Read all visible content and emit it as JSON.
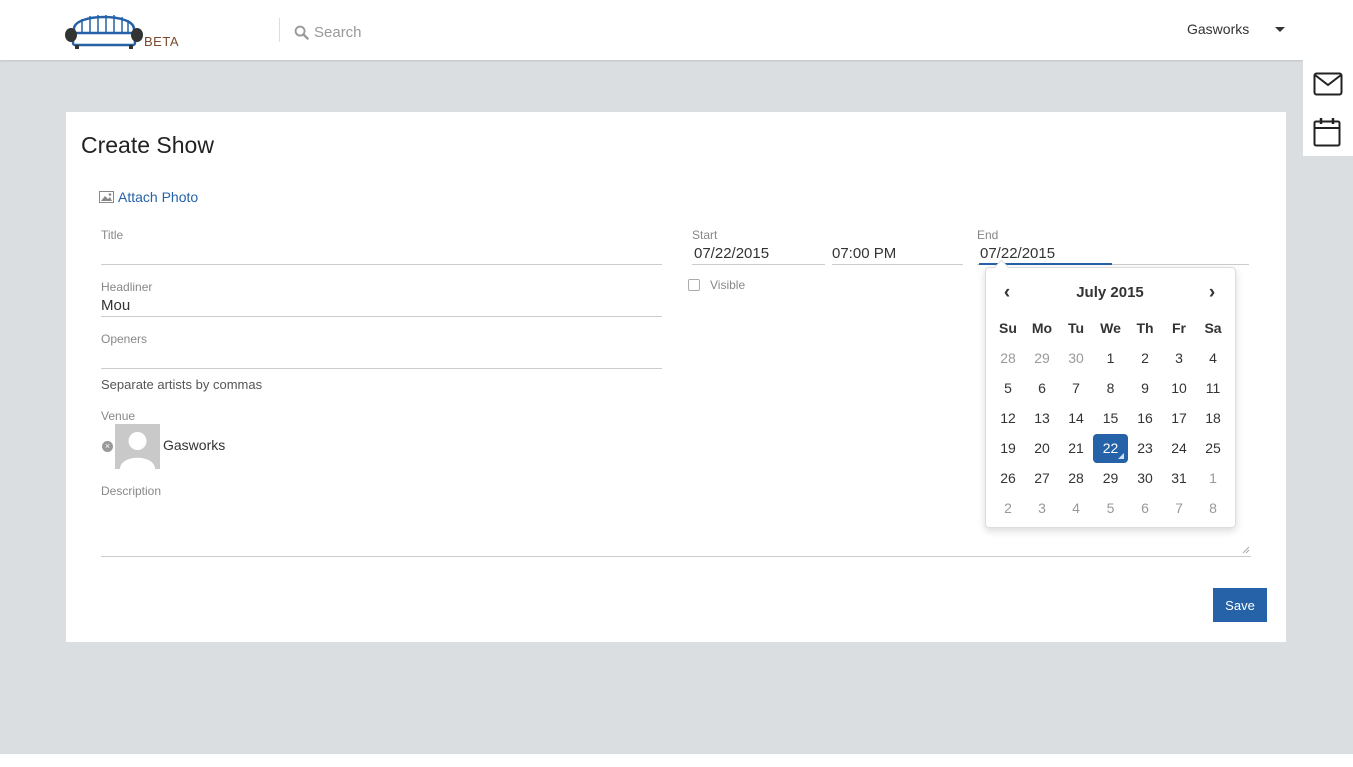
{
  "header": {
    "logo_label": "BETA",
    "search_placeholder": "Search",
    "user_menu_label": "Gasworks"
  },
  "dock": {
    "icons": [
      "envelope-icon",
      "calendar-icon"
    ]
  },
  "form": {
    "title": "Create Show",
    "attach_photo_label": "Attach Photo",
    "title_label": "Title",
    "title_value": "",
    "headliner_label": "Headliner",
    "headliner_value": "Mou",
    "openers_label": "Openers",
    "openers_value": "",
    "openers_hint": "Separate artists by commas",
    "venue_label": "Venue",
    "venue_name": "Gasworks",
    "description_label": "Description",
    "description_value": "",
    "start_label": "Start",
    "start_date": "07/22/2015",
    "start_time": "07:00 PM",
    "end_label": "End",
    "end_date": "07/22/2015",
    "visible_label": "Visible",
    "visible_checked": false,
    "save_label": "Save"
  },
  "datepicker": {
    "month_label": "July 2015",
    "prev_label": "‹",
    "next_label": "›",
    "weekdays": [
      "Su",
      "Mo",
      "Tu",
      "We",
      "Th",
      "Fr",
      "Sa"
    ],
    "weeks": [
      [
        {
          "d": "28",
          "m": "prev"
        },
        {
          "d": "29",
          "m": "prev"
        },
        {
          "d": "30",
          "m": "prev"
        },
        {
          "d": "1",
          "m": "cur"
        },
        {
          "d": "2",
          "m": "cur"
        },
        {
          "d": "3",
          "m": "cur"
        },
        {
          "d": "4",
          "m": "cur"
        }
      ],
      [
        {
          "d": "5",
          "m": "cur"
        },
        {
          "d": "6",
          "m": "cur"
        },
        {
          "d": "7",
          "m": "cur"
        },
        {
          "d": "8",
          "m": "cur"
        },
        {
          "d": "9",
          "m": "cur"
        },
        {
          "d": "10",
          "m": "cur"
        },
        {
          "d": "11",
          "m": "cur"
        }
      ],
      [
        {
          "d": "12",
          "m": "cur"
        },
        {
          "d": "13",
          "m": "cur"
        },
        {
          "d": "14",
          "m": "cur"
        },
        {
          "d": "15",
          "m": "cur"
        },
        {
          "d": "16",
          "m": "cur"
        },
        {
          "d": "17",
          "m": "cur"
        },
        {
          "d": "18",
          "m": "cur"
        }
      ],
      [
        {
          "d": "19",
          "m": "cur"
        },
        {
          "d": "20",
          "m": "cur"
        },
        {
          "d": "21",
          "m": "cur"
        },
        {
          "d": "22",
          "m": "sel"
        },
        {
          "d": "23",
          "m": "cur"
        },
        {
          "d": "24",
          "m": "cur"
        },
        {
          "d": "25",
          "m": "cur"
        }
      ],
      [
        {
          "d": "26",
          "m": "cur"
        },
        {
          "d": "27",
          "m": "cur"
        },
        {
          "d": "28",
          "m": "cur"
        },
        {
          "d": "29",
          "m": "cur"
        },
        {
          "d": "30",
          "m": "cur"
        },
        {
          "d": "31",
          "m": "cur"
        },
        {
          "d": "1",
          "m": "next"
        }
      ],
      [
        {
          "d": "2",
          "m": "next"
        },
        {
          "d": "3",
          "m": "next"
        },
        {
          "d": "4",
          "m": "next"
        },
        {
          "d": "5",
          "m": "next"
        },
        {
          "d": "6",
          "m": "next"
        },
        {
          "d": "7",
          "m": "next"
        },
        {
          "d": "8",
          "m": "next"
        }
      ]
    ]
  },
  "colors": {
    "accent": "#2562a8",
    "background": "#dadee1"
  }
}
